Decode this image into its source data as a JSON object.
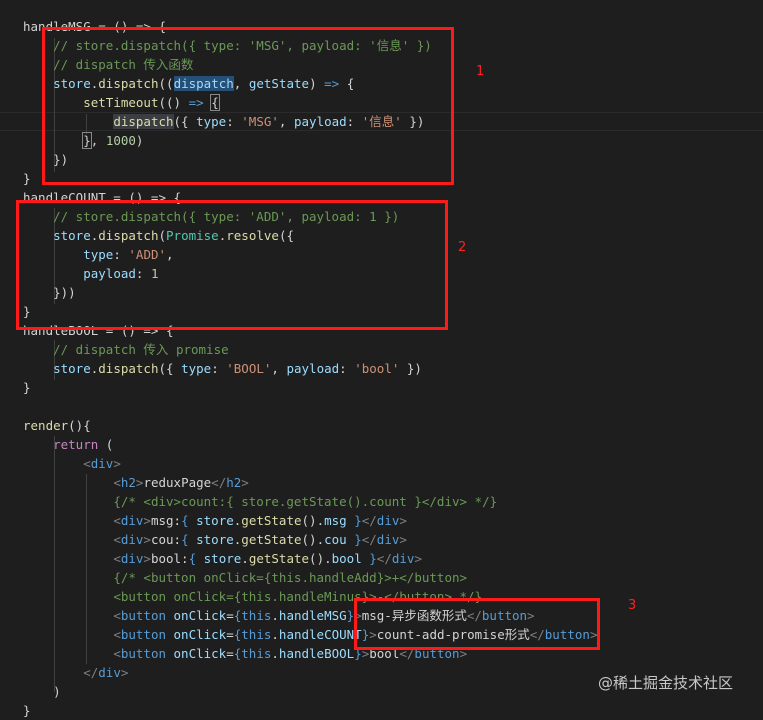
{
  "code_lines": [
    [
      {
        "t": "handleMSG = () => {",
        "c": "txt"
      }
    ],
    [
      {
        "t": "    ",
        "c": "txt"
      },
      {
        "t": "// store.dispatch({ type: 'MSG', payload: '信息' })",
        "c": "comment"
      }
    ],
    [
      {
        "t": "    ",
        "c": "txt"
      },
      {
        "t": "// dispatch 传入函数",
        "c": "comment"
      }
    ],
    [
      {
        "t": "    ",
        "c": "txt"
      },
      {
        "t": "store",
        "c": "var"
      },
      {
        "t": ".",
        "c": "txt"
      },
      {
        "t": "dispatch",
        "c": "fn"
      },
      {
        "t": "((",
        "c": "txt"
      },
      {
        "t": "dispatch",
        "c": "var",
        "hl": "sel"
      },
      {
        "t": ", ",
        "c": "txt"
      },
      {
        "t": "getState",
        "c": "var"
      },
      {
        "t": ") ",
        "c": "txt"
      },
      {
        "t": "=>",
        "c": "kw2"
      },
      {
        "t": " {",
        "c": "txt"
      }
    ],
    [
      {
        "t": "        ",
        "c": "txt"
      },
      {
        "t": "setTimeout",
        "c": "fn"
      },
      {
        "t": "(() ",
        "c": "txt"
      },
      {
        "t": "=>",
        "c": "kw2"
      },
      {
        "t": " ",
        "c": "txt"
      },
      {
        "t": "{",
        "c": "txt",
        "hl": "brk"
      }
    ],
    [
      {
        "t": "            ",
        "c": "txt"
      },
      {
        "t": "dispatch",
        "c": "fn",
        "hl": "word"
      },
      {
        "t": "({ ",
        "c": "txt"
      },
      {
        "t": "type",
        "c": "var"
      },
      {
        "t": ": ",
        "c": "txt"
      },
      {
        "t": "'MSG'",
        "c": "str"
      },
      {
        "t": ", ",
        "c": "txt"
      },
      {
        "t": "payload",
        "c": "var"
      },
      {
        "t": ": ",
        "c": "txt"
      },
      {
        "t": "'信息'",
        "c": "str"
      },
      {
        "t": " })",
        "c": "txt"
      }
    ],
    [
      {
        "t": "        ",
        "c": "txt"
      },
      {
        "t": "}",
        "c": "txt",
        "hl": "brk"
      },
      {
        "t": ", ",
        "c": "txt"
      },
      {
        "t": "1000",
        "c": "num"
      },
      {
        "t": ")",
        "c": "txt"
      }
    ],
    [
      {
        "t": "    })",
        "c": "txt"
      }
    ],
    [
      {
        "t": "}",
        "c": "txt"
      }
    ],
    [
      {
        "t": "handleCOUNT = () => {",
        "c": "txt"
      }
    ],
    [
      {
        "t": "    ",
        "c": "txt"
      },
      {
        "t": "// store.dispatch({ type: 'ADD', payload: 1 })",
        "c": "comment"
      }
    ],
    [
      {
        "t": "    ",
        "c": "txt"
      },
      {
        "t": "store",
        "c": "var"
      },
      {
        "t": ".",
        "c": "txt"
      },
      {
        "t": "dispatch",
        "c": "fn"
      },
      {
        "t": "(",
        "c": "txt"
      },
      {
        "t": "Promise",
        "c": "cls"
      },
      {
        "t": ".",
        "c": "txt"
      },
      {
        "t": "resolve",
        "c": "fn"
      },
      {
        "t": "({",
        "c": "txt"
      }
    ],
    [
      {
        "t": "        ",
        "c": "txt"
      },
      {
        "t": "type",
        "c": "var"
      },
      {
        "t": ": ",
        "c": "txt"
      },
      {
        "t": "'ADD'",
        "c": "str"
      },
      {
        "t": ",",
        "c": "txt"
      }
    ],
    [
      {
        "t": "        ",
        "c": "txt"
      },
      {
        "t": "payload",
        "c": "var"
      },
      {
        "t": ": ",
        "c": "txt"
      },
      {
        "t": "1",
        "c": "num"
      }
    ],
    [
      {
        "t": "    }))",
        "c": "txt"
      }
    ],
    [
      {
        "t": "}",
        "c": "txt"
      }
    ],
    [
      {
        "t": "handleBOOL = () => {",
        "c": "txt"
      }
    ],
    [
      {
        "t": "    ",
        "c": "txt"
      },
      {
        "t": "// dispatch 传入 promise",
        "c": "comment"
      }
    ],
    [
      {
        "t": "    ",
        "c": "txt"
      },
      {
        "t": "store",
        "c": "var"
      },
      {
        "t": ".",
        "c": "txt"
      },
      {
        "t": "dispatch",
        "c": "fn"
      },
      {
        "t": "({ ",
        "c": "txt"
      },
      {
        "t": "type",
        "c": "var"
      },
      {
        "t": ": ",
        "c": "txt"
      },
      {
        "t": "'BOOL'",
        "c": "str"
      },
      {
        "t": ", ",
        "c": "txt"
      },
      {
        "t": "payload",
        "c": "var"
      },
      {
        "t": ": ",
        "c": "txt"
      },
      {
        "t": "'bool'",
        "c": "str"
      },
      {
        "t": " })",
        "c": "txt"
      }
    ],
    [
      {
        "t": "}",
        "c": "txt"
      }
    ],
    [
      {
        "t": "",
        "c": "txt"
      }
    ],
    [
      {
        "t": "render",
        "c": "fn"
      },
      {
        "t": "(){",
        "c": "txt"
      }
    ],
    [
      {
        "t": "    ",
        "c": "txt"
      },
      {
        "t": "return",
        "c": "kw"
      },
      {
        "t": " (",
        "c": "txt"
      }
    ],
    [
      {
        "t": "        ",
        "c": "txt"
      },
      {
        "t": "<",
        "c": "brk"
      },
      {
        "t": "div",
        "c": "tag"
      },
      {
        "t": ">",
        "c": "brk"
      }
    ],
    [
      {
        "t": "            ",
        "c": "txt"
      },
      {
        "t": "<",
        "c": "brk"
      },
      {
        "t": "h2",
        "c": "tag"
      },
      {
        "t": ">",
        "c": "brk"
      },
      {
        "t": "reduxPage",
        "c": "txt"
      },
      {
        "t": "</",
        "c": "brk"
      },
      {
        "t": "h2",
        "c": "tag"
      },
      {
        "t": ">",
        "c": "brk"
      }
    ],
    [
      {
        "t": "            ",
        "c": "txt"
      },
      {
        "t": "{/* <div>count:{ store.getState().count }</div> */}",
        "c": "comment"
      }
    ],
    [
      {
        "t": "            ",
        "c": "txt"
      },
      {
        "t": "<",
        "c": "brk"
      },
      {
        "t": "div",
        "c": "tag"
      },
      {
        "t": ">",
        "c": "brk"
      },
      {
        "t": "msg:",
        "c": "txt"
      },
      {
        "t": "{ ",
        "c": "kw2"
      },
      {
        "t": "store",
        "c": "var"
      },
      {
        "t": ".",
        "c": "txt"
      },
      {
        "t": "getState",
        "c": "fn"
      },
      {
        "t": "().",
        "c": "txt"
      },
      {
        "t": "msg",
        "c": "var"
      },
      {
        "t": " }",
        "c": "kw2"
      },
      {
        "t": "</",
        "c": "brk"
      },
      {
        "t": "div",
        "c": "tag"
      },
      {
        "t": ">",
        "c": "brk"
      }
    ],
    [
      {
        "t": "            ",
        "c": "txt"
      },
      {
        "t": "<",
        "c": "brk"
      },
      {
        "t": "div",
        "c": "tag"
      },
      {
        "t": ">",
        "c": "brk"
      },
      {
        "t": "cou:",
        "c": "txt"
      },
      {
        "t": "{ ",
        "c": "kw2"
      },
      {
        "t": "store",
        "c": "var"
      },
      {
        "t": ".",
        "c": "txt"
      },
      {
        "t": "getState",
        "c": "fn"
      },
      {
        "t": "().",
        "c": "txt"
      },
      {
        "t": "cou",
        "c": "var"
      },
      {
        "t": " }",
        "c": "kw2"
      },
      {
        "t": "</",
        "c": "brk"
      },
      {
        "t": "div",
        "c": "tag"
      },
      {
        "t": ">",
        "c": "brk"
      }
    ],
    [
      {
        "t": "            ",
        "c": "txt"
      },
      {
        "t": "<",
        "c": "brk"
      },
      {
        "t": "div",
        "c": "tag"
      },
      {
        "t": ">",
        "c": "brk"
      },
      {
        "t": "bool:",
        "c": "txt"
      },
      {
        "t": "{ ",
        "c": "kw2"
      },
      {
        "t": "store",
        "c": "var"
      },
      {
        "t": ".",
        "c": "txt"
      },
      {
        "t": "getState",
        "c": "fn"
      },
      {
        "t": "().",
        "c": "txt"
      },
      {
        "t": "bool",
        "c": "var"
      },
      {
        "t": " }",
        "c": "kw2"
      },
      {
        "t": "</",
        "c": "brk"
      },
      {
        "t": "div",
        "c": "tag"
      },
      {
        "t": ">",
        "c": "brk"
      }
    ],
    [
      {
        "t": "            ",
        "c": "txt"
      },
      {
        "t": "{/* <button onClick={this.handleAdd}>+</button>",
        "c": "comment"
      }
    ],
    [
      {
        "t": "            ",
        "c": "txt"
      },
      {
        "t": "<button onClick={this.handleMinus}>-</button> */}",
        "c": "comment"
      }
    ],
    [
      {
        "t": "            ",
        "c": "txt"
      },
      {
        "t": "<",
        "c": "brk"
      },
      {
        "t": "button",
        "c": "tag"
      },
      {
        "t": " ",
        "c": "txt"
      },
      {
        "t": "onClick",
        "c": "var"
      },
      {
        "t": "=",
        "c": "txt"
      },
      {
        "t": "{",
        "c": "kw2"
      },
      {
        "t": "this",
        "c": "kw2"
      },
      {
        "t": ".",
        "c": "txt"
      },
      {
        "t": "handleMSG",
        "c": "var"
      },
      {
        "t": "}",
        "c": "kw2"
      },
      {
        "t": ">",
        "c": "brk"
      },
      {
        "t": "msg-异步函数形式",
        "c": "txt"
      },
      {
        "t": "</",
        "c": "brk"
      },
      {
        "t": "button",
        "c": "tag"
      },
      {
        "t": ">",
        "c": "brk"
      }
    ],
    [
      {
        "t": "            ",
        "c": "txt"
      },
      {
        "t": "<",
        "c": "brk"
      },
      {
        "t": "button",
        "c": "tag"
      },
      {
        "t": " ",
        "c": "txt"
      },
      {
        "t": "onClick",
        "c": "var"
      },
      {
        "t": "=",
        "c": "txt"
      },
      {
        "t": "{",
        "c": "kw2"
      },
      {
        "t": "this",
        "c": "kw2"
      },
      {
        "t": ".",
        "c": "txt"
      },
      {
        "t": "handleCOUNT",
        "c": "var"
      },
      {
        "t": "}",
        "c": "kw2"
      },
      {
        "t": ">",
        "c": "brk"
      },
      {
        "t": "count-add-promise形式",
        "c": "txt"
      },
      {
        "t": "</",
        "c": "brk"
      },
      {
        "t": "button",
        "c": "tag"
      },
      {
        "t": ">",
        "c": "brk"
      }
    ],
    [
      {
        "t": "            ",
        "c": "txt"
      },
      {
        "t": "<",
        "c": "brk"
      },
      {
        "t": "button",
        "c": "tag"
      },
      {
        "t": " ",
        "c": "txt"
      },
      {
        "t": "onClick",
        "c": "var"
      },
      {
        "t": "=",
        "c": "txt"
      },
      {
        "t": "{",
        "c": "kw2"
      },
      {
        "t": "this",
        "c": "kw2"
      },
      {
        "t": ".",
        "c": "txt"
      },
      {
        "t": "handleBOOL",
        "c": "var"
      },
      {
        "t": "}",
        "c": "kw2"
      },
      {
        "t": ">",
        "c": "brk"
      },
      {
        "t": "bool",
        "c": "txt"
      },
      {
        "t": "</",
        "c": "brk"
      },
      {
        "t": "button",
        "c": "tag"
      },
      {
        "t": ">",
        "c": "brk"
      }
    ],
    [
      {
        "t": "        ",
        "c": "txt"
      },
      {
        "t": "</",
        "c": "brk"
      },
      {
        "t": "div",
        "c": "tag"
      },
      {
        "t": ">",
        "c": "brk"
      }
    ],
    [
      {
        "t": "    )",
        "c": "txt"
      }
    ],
    [
      {
        "t": "}",
        "c": "txt"
      }
    ]
  ],
  "annotations": {
    "label_1": "1",
    "label_2": "2",
    "label_3": "3"
  },
  "watermark": "@稀土掘金技术社区",
  "colors": {
    "background": "#1e1e1e",
    "annotation_red": "#ff1a1a",
    "comment": "#6a9955",
    "string": "#ce9178",
    "function": "#dcdcaa",
    "variable": "#9cdcfe",
    "keyword": "#569cd6"
  }
}
